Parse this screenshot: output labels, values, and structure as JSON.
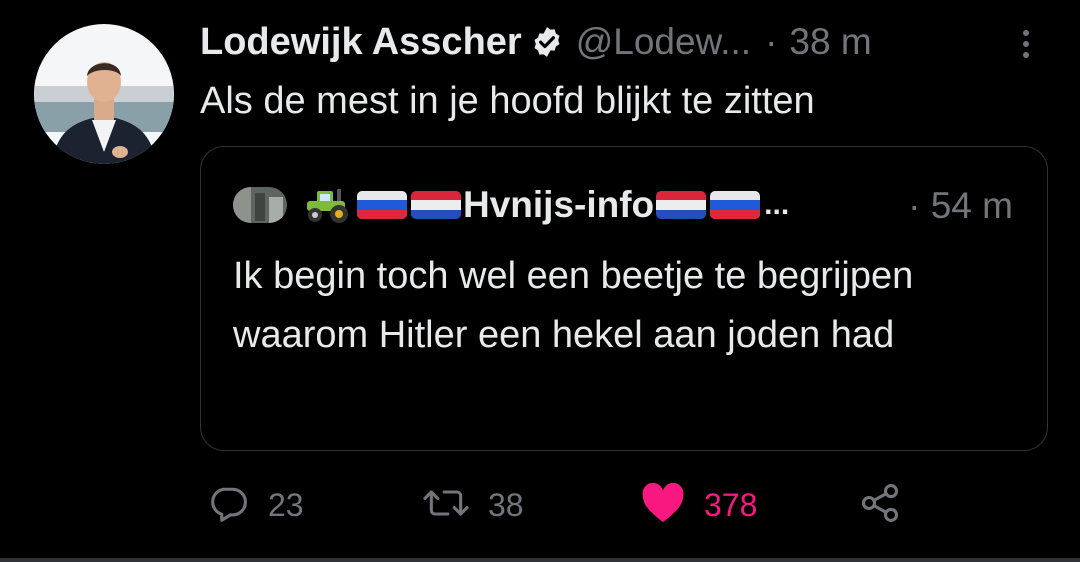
{
  "tweet": {
    "author_name": "Lodewijk Asscher",
    "handle": "@Lodew...",
    "separator": "·",
    "time": "38 m",
    "text": "Als de mest in je hoofd blijkt te zitten",
    "verified_icon": "verified-badge-icon",
    "more_icon": "more-vertical-icon"
  },
  "quote": {
    "author_name": "Hvnijs-info",
    "ellipsis": "...",
    "separator": "·",
    "time": "54 m",
    "text": "Ik begin toch wel een beetje te begrijpen waarom Hitler een hekel aan joden had",
    "name_emojis": [
      "tractor",
      "flag-russia",
      "flag-netherlands"
    ],
    "trailing_emojis": [
      "flag-netherlands",
      "flag-russia"
    ]
  },
  "actions": {
    "reply_count": "23",
    "retweet_count": "38",
    "like_count": "378",
    "icons": [
      "reply-icon",
      "retweet-icon",
      "heart-icon",
      "share-icon"
    ]
  },
  "colors": {
    "background": "#000000",
    "text": "#e7e9ea",
    "secondary": "#71767b",
    "like": "#f91880",
    "border": "#2f3336"
  }
}
